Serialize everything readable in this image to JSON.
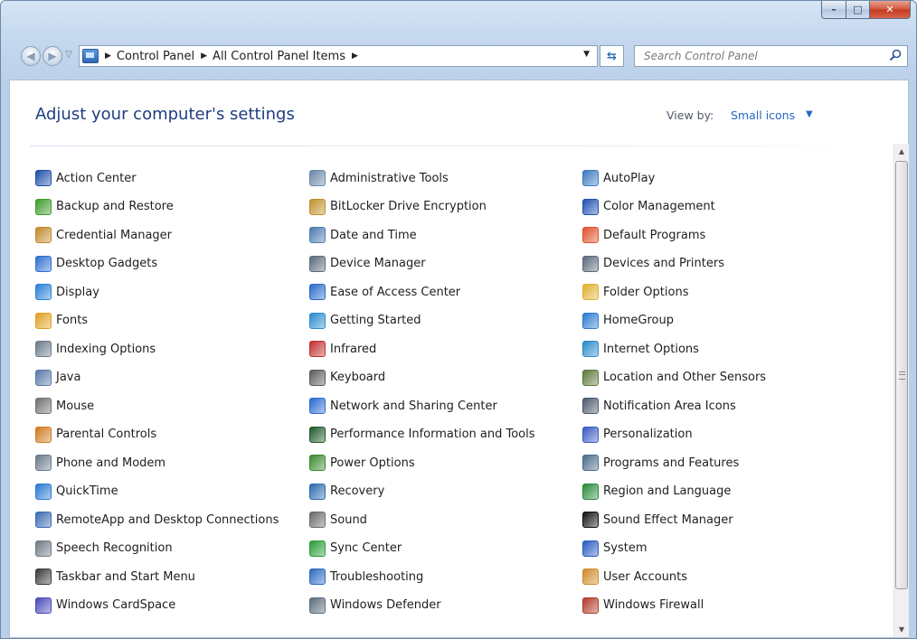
{
  "window": {
    "buttons": {
      "minimize": "–",
      "maximize": "□",
      "close": "✕"
    }
  },
  "navigation": {
    "back_icon": "back-arrow-icon",
    "forward_icon": "forward-arrow-icon",
    "breadcrumb": [
      "Control Panel",
      "All Control Panel Items"
    ],
    "search_placeholder": "Search Control Panel"
  },
  "header": {
    "title": "Adjust your computer's settings",
    "view_by_label": "View by:",
    "view_by_value": "Small icons"
  },
  "items": [
    [
      {
        "label": "Action Center",
        "icon": "flag-icon",
        "color": "#1f4fa8"
      },
      {
        "label": "Backup and Restore",
        "icon": "backup-icon",
        "color": "#3f9a2c"
      },
      {
        "label": "Credential Manager",
        "icon": "vault-icon",
        "color": "#c08a2a"
      },
      {
        "label": "Desktop Gadgets",
        "icon": "gadgets-icon",
        "color": "#2f6fd0"
      },
      {
        "label": "Display",
        "icon": "monitor-icon",
        "color": "#2a7fd8"
      },
      {
        "label": "Fonts",
        "icon": "fonts-icon",
        "color": "#e0a020"
      },
      {
        "label": "Indexing Options",
        "icon": "indexing-icon",
        "color": "#6a7a8a"
      },
      {
        "label": "Java",
        "icon": "java-icon",
        "color": "#5878a8"
      },
      {
        "label": "Mouse",
        "icon": "mouse-icon",
        "color": "#707070"
      },
      {
        "label": "Parental Controls",
        "icon": "parental-icon",
        "color": "#d07a20"
      },
      {
        "label": "Phone and Modem",
        "icon": "phone-icon",
        "color": "#6a7a8a"
      },
      {
        "label": "QuickTime",
        "icon": "quicktime-icon",
        "color": "#2a78d0"
      },
      {
        "label": "RemoteApp and Desktop Connections",
        "icon": "remoteapp-icon",
        "color": "#3a6ab0"
      },
      {
        "label": "Speech Recognition",
        "icon": "microphone-icon",
        "color": "#707a86"
      },
      {
        "label": "Taskbar and Start Menu",
        "icon": "taskbar-icon",
        "color": "#3a3a3a"
      },
      {
        "label": "Windows CardSpace",
        "icon": "cardspace-icon",
        "color": "#4a4ab8"
      }
    ],
    [
      {
        "label": "Administrative Tools",
        "icon": "admin-tools-icon",
        "color": "#6a86a8"
      },
      {
        "label": "BitLocker Drive Encryption",
        "icon": "bitlocker-icon",
        "color": "#c0902a"
      },
      {
        "label": "Date and Time",
        "icon": "clock-icon",
        "color": "#4a7ab0"
      },
      {
        "label": "Device Manager",
        "icon": "device-manager-icon",
        "color": "#5a6a7a"
      },
      {
        "label": "Ease of Access Center",
        "icon": "ease-of-access-icon",
        "color": "#2a6ac8"
      },
      {
        "label": "Getting Started",
        "icon": "getting-started-icon",
        "color": "#2a8ad0"
      },
      {
        "label": "Infrared",
        "icon": "infrared-icon",
        "color": "#c03030"
      },
      {
        "label": "Keyboard",
        "icon": "keyboard-icon",
        "color": "#5a5a5a"
      },
      {
        "label": "Network and Sharing Center",
        "icon": "network-icon",
        "color": "#2a6ad0"
      },
      {
        "label": "Performance Information and Tools",
        "icon": "performance-icon",
        "color": "#1f5a2a"
      },
      {
        "label": "Power Options",
        "icon": "power-icon",
        "color": "#3a8a2a"
      },
      {
        "label": "Recovery",
        "icon": "recovery-icon",
        "color": "#2a6ab0"
      },
      {
        "label": "Sound",
        "icon": "speaker-icon",
        "color": "#6a6a6a"
      },
      {
        "label": "Sync Center",
        "icon": "sync-icon",
        "color": "#2a9a3a"
      },
      {
        "label": "Troubleshooting",
        "icon": "troubleshooting-icon",
        "color": "#2a6ac0"
      },
      {
        "label": "Windows Defender",
        "icon": "defender-icon",
        "color": "#5a6a7a"
      }
    ],
    [
      {
        "label": "AutoPlay",
        "icon": "autoplay-icon",
        "color": "#3a7ac0"
      },
      {
        "label": "Color Management",
        "icon": "color-management-icon",
        "color": "#2050b0"
      },
      {
        "label": "Default Programs",
        "icon": "default-programs-icon",
        "color": "#e0502a"
      },
      {
        "label": "Devices and Printers",
        "icon": "printer-icon",
        "color": "#5a6a7a"
      },
      {
        "label": "Folder Options",
        "icon": "folder-icon",
        "color": "#e0b030"
      },
      {
        "label": "HomeGroup",
        "icon": "homegroup-icon",
        "color": "#2a7ad0"
      },
      {
        "label": "Internet Options",
        "icon": "internet-options-icon",
        "color": "#2a8ac8"
      },
      {
        "label": "Location and Other Sensors",
        "icon": "sensors-icon",
        "color": "#5a7a3a"
      },
      {
        "label": "Notification Area Icons",
        "icon": "notification-area-icon",
        "color": "#4a5a6a"
      },
      {
        "label": "Personalization",
        "icon": "personalization-icon",
        "color": "#3a5ac0"
      },
      {
        "label": "Programs and Features",
        "icon": "programs-icon",
        "color": "#4a6a8a"
      },
      {
        "label": "Region and Language",
        "icon": "globe-icon",
        "color": "#2a8a3a"
      },
      {
        "label": "Sound Effect Manager",
        "icon": "sound-effect-icon",
        "color": "#101010"
      },
      {
        "label": "System",
        "icon": "system-icon",
        "color": "#2a5ac0"
      },
      {
        "label": "User Accounts",
        "icon": "user-accounts-icon",
        "color": "#d08a2a"
      },
      {
        "label": "Windows Firewall",
        "icon": "firewall-icon",
        "color": "#b03a2a"
      }
    ]
  ]
}
